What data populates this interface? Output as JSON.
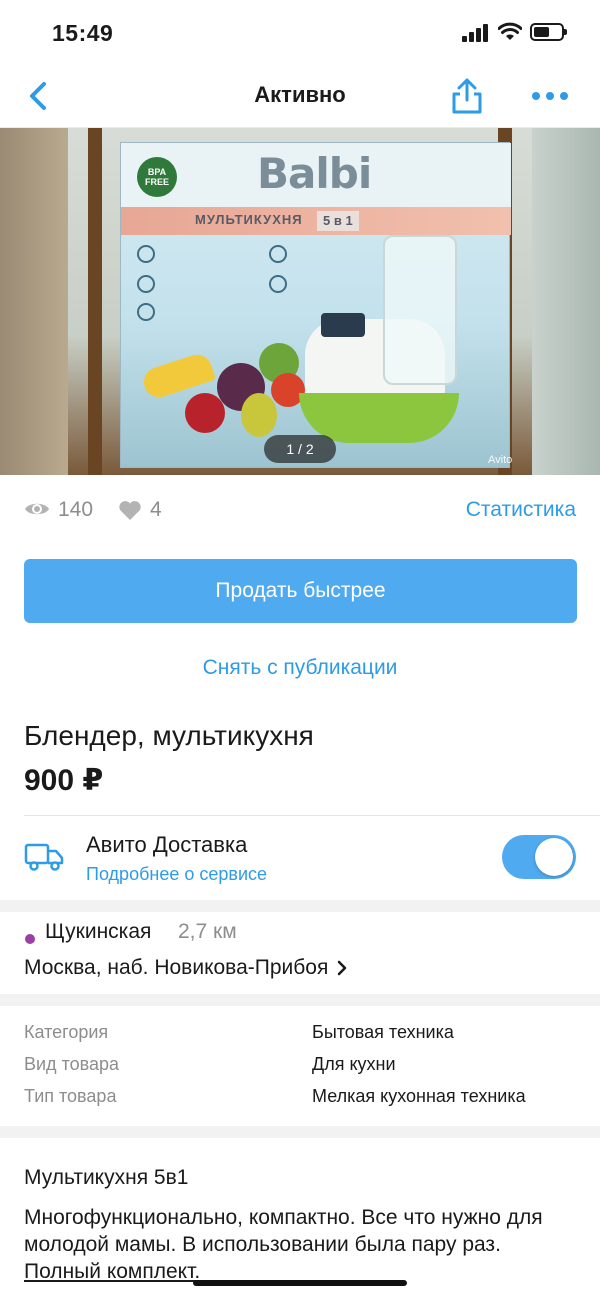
{
  "status_bar": {
    "time": "15:49"
  },
  "nav": {
    "title": "Активно",
    "icons": [
      "chevron-left-icon",
      "share-icon",
      "more-icon"
    ]
  },
  "gallery": {
    "counter": "1 / 2",
    "watermark": "Avito",
    "photo": {
      "brand": "Balbi",
      "banner": "МУЛЬТИКУХНЯ",
      "banner_tag": "5 в 1",
      "badge": "BPA FREE"
    }
  },
  "stats": {
    "views": "140",
    "likes": "4",
    "link": "Статистика"
  },
  "actions": {
    "sell_faster": "Продать быстрее",
    "unpublish": "Снять с публикации"
  },
  "item": {
    "title": "Блендер, мультикухня",
    "price": "900 ₽"
  },
  "delivery": {
    "title": "Авито Доставка",
    "link": "Подробнее о сервисе",
    "enabled": true,
    "accent": "#4faaf0"
  },
  "location": {
    "metro": "Щукинская",
    "distance": "2,7 км",
    "metro_color": "#9b3fa3",
    "address": "Москва, наб. Новикова-Прибоя"
  },
  "params": [
    {
      "label": "Категория",
      "value": "Бытовая техника"
    },
    {
      "label": "Вид товара",
      "value": "Для кухни"
    },
    {
      "label": "Тип товара",
      "value": "Мелкая кухонная техника"
    }
  ],
  "description": {
    "title": "Мультикухня 5в1",
    "body": "Многофункционально, компактно. Все что нужно для молодой мамы. В использовании была пару раз. ",
    "body_underlined": "Полный комплект."
  }
}
